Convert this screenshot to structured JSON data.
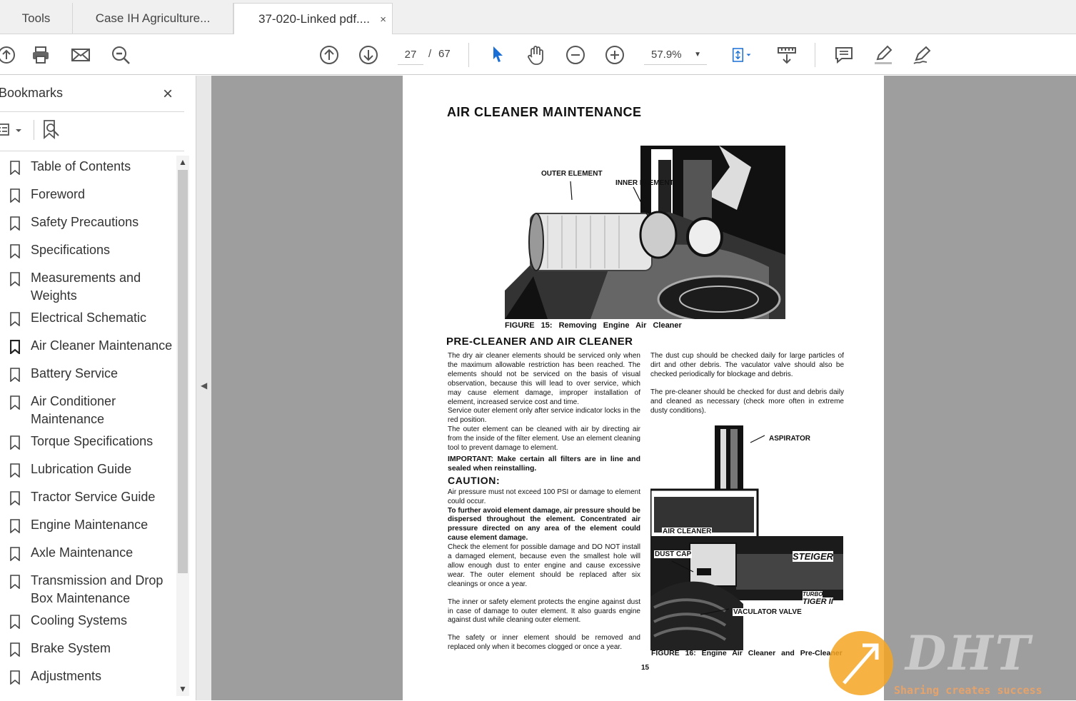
{
  "tabs": {
    "tools": "Tools",
    "tab1": "Case IH Agriculture...",
    "tab2": "37-020-Linked pdf....",
    "close": "×"
  },
  "toolbar": {
    "page_current": "27",
    "page_sep": "/",
    "page_total": "67",
    "zoom": "57.9%"
  },
  "sidebar": {
    "title": "Bookmarks",
    "close": "×",
    "items": [
      {
        "label": "Table of Contents"
      },
      {
        "label": "Foreword"
      },
      {
        "label": "Safety Precautions"
      },
      {
        "label": "Specifications"
      },
      {
        "label": "Measurements and Weights"
      },
      {
        "label": "Electrical Schematic"
      },
      {
        "label": "Air Cleaner Maintenance"
      },
      {
        "label": "Battery Service"
      },
      {
        "label": "Air Conditioner Maintenance"
      },
      {
        "label": "Torque Specifications"
      },
      {
        "label": "Lubrication Guide"
      },
      {
        "label": "Tractor Service Guide"
      },
      {
        "label": "Engine Maintenance"
      },
      {
        "label": "Axle Maintenance"
      },
      {
        "label": "Transmission and Drop Box Maintenance"
      },
      {
        "label": "Cooling Systems"
      },
      {
        "label": "Brake System"
      },
      {
        "label": "Adjustments"
      }
    ]
  },
  "doc": {
    "title": "AIR CLEANER MAINTENANCE",
    "fig1_labels": {
      "outer": "OUTER ELEMENT",
      "inner": "INNER ELEMENT"
    },
    "fig1_caption": "FIGURE 15: Removing Engine Air Cleaner",
    "section": "PRE-CLEANER AND AIR CLEANER",
    "left": {
      "p1": "The dry air cleaner elements should be serviced only when the maximum allowable restriction has been reached. The elements should not be serviced on the basis of visual observation, because this will lead to over service, which may cause element damage, improper installation of element, increased service cost and time.",
      "p2": "Service outer element only after service indicator locks in the red position.",
      "p3": "The outer element can be cleaned with air by directing air from the inside of the filter element. Use an element cleaning tool to prevent damage to element.",
      "p4": "IMPORTANT: Make certain all filters are in line and sealed when reinstalling.",
      "caution": "CAUTION:",
      "p5": "Air pressure must not exceed 100 PSI or damage to element could occur.",
      "p6": "To further avoid element damage, air pressure should be dispersed throughout the element. Concentrated air pressure directed on any area of the element could cause element damage.",
      "p7": "Check the element for possible damage and DO NOT install a damaged element, because even the smallest hole will allow enough dust to enter engine and cause excessive wear. The outer element should be replaced after six cleanings or once a year.",
      "p8": "The inner or safety element protects the engine against dust in case of damage to outer element. It also guards engine against dust while cleaning outer element.",
      "p9": "The safety or inner element should be removed and replaced only when it becomes clogged or once a year."
    },
    "right": {
      "p1": "The dust cup should be checked daily for large particles of dirt and other debris. The vaculator valve should also be checked periodically for blockage and debris.",
      "p2": "The pre-cleaner should be checked for dust and debris daily and cleaned as necessary (check more often in extreme dusty conditions)."
    },
    "fig2_labels": {
      "aspirator": "ASPIRATOR",
      "air_cleaner": "AIR CLEANER",
      "dust_cap": "DUST CAP",
      "steiger": "STEIGER",
      "turbo": "TURBO",
      "tiger": "TIGER II",
      "vaculator": "VACULATOR VALVE"
    },
    "fig2_caption": "FIGURE 16: Engine Air Cleaner and Pre-Cleaner",
    "page_number": "15"
  },
  "watermark": {
    "brand": "DHT",
    "tagline": "Sharing creates success"
  }
}
